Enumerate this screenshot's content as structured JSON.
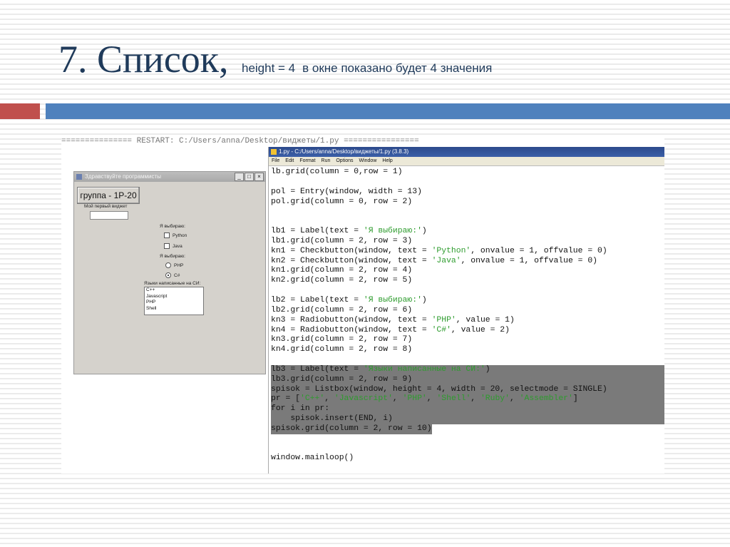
{
  "slide": {
    "title_main": "7. Список,",
    "title_sub_a": "height = 4",
    "title_sub_b": "в окне показано будет 4 значения"
  },
  "shell": {
    "restart_line": "=============== RESTART: C:/Users/anna/Desktop/виджеты/1.py ================"
  },
  "tk_window": {
    "title": "Здравствуйте программисты",
    "min_btn": "_",
    "max_btn": "□",
    "close_btn": "×",
    "group_button": "группа - 1P-20",
    "label_first_widget": "Мой первый виджет",
    "label_choose_1": "Я выбираю:",
    "check_python": "Python",
    "check_java": "Java",
    "label_choose_2": "Я выбираю:",
    "radio_php": "PHP",
    "radio_csharp": "C#",
    "label_languages": "Языки написанные на СИ:",
    "listbox_items": [
      "C++",
      "Javascript",
      "PHP",
      "Shell"
    ]
  },
  "idle": {
    "title": "1.py - C:/Users/anna/Desktop/виджеты/1.py (3.8.3)",
    "menu": [
      "File",
      "Edit",
      "Format",
      "Run",
      "Options",
      "Window",
      "Help"
    ],
    "code": [
      "lb.grid(column = 0,row = 1)",
      "",
      "pol = Entry(window, width = 13)",
      "pol.grid(column = 0, row = 2)",
      "",
      "",
      "lb1 = Label(text = 'Я выбираю:')",
      "lb1.grid(column = 2, row = 3)",
      "kn1 = Checkbutton(window, text = 'Python', onvalue = 1, offvalue = 0)",
      "kn2 = Checkbutton(window, text = 'Java', onvalue = 1, offvalue = 0)",
      "kn1.grid(column = 2, row = 4)",
      "kn2.grid(column = 2, row = 5)",
      "",
      "lb2 = Label(text = 'Я выбираю:')",
      "lb2.grid(column = 2, row = 6)",
      "kn3 = Radiobutton(window, text = 'PHP', value = 1)",
      "kn4 = Radiobutton(window, text = 'C#', value = 2)",
      "kn3.grid(column = 2, row = 7)",
      "kn4.grid(column = 2, row = 8)",
      "",
      "lb3 = Label(text = 'Языки написанные на СИ:')",
      "lb3.grid(column = 2, row = 9)",
      "spisok = Listbox(window, height = 4, width = 20, selectmode = SINGLE)",
      "pr = ['C++', 'Javascript', 'PHP', 'Shell', 'Ruby', 'Assembler']",
      "for i in pr:",
      "    spisok.insert(END, i)",
      "spisok.grid(column = 2, row = 10)",
      "",
      "",
      "window.mainloop()"
    ],
    "highlight_start": 20,
    "highlight_end": 26
  },
  "colors": {
    "title": "#1f3a5a",
    "bar_red": "#c0504d",
    "bar_blue": "#4f81bd",
    "selection": "#7a7a7a",
    "string": "#2e9c2e"
  }
}
